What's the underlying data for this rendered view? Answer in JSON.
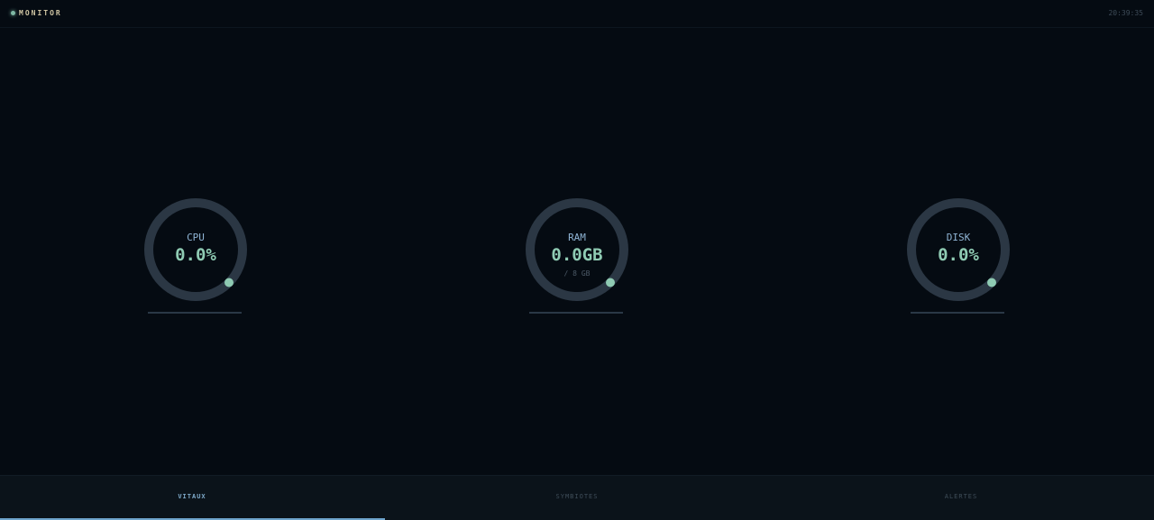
{
  "header": {
    "title": "MONITOR",
    "time": "20:39:35"
  },
  "gauges": {
    "cpu": {
      "label": "CPU",
      "value": "0.0%",
      "fraction": 0.0
    },
    "ram": {
      "label": "RAM",
      "value": "0.0GB",
      "sub": "/ 8 GB",
      "fraction": 0.0
    },
    "disk": {
      "label": "DISK",
      "value": "0.0%",
      "fraction": 0.0
    }
  },
  "nav": {
    "tabs": [
      {
        "label": "VITAUX",
        "active": true
      },
      {
        "label": "SYMBIOTES",
        "active": false
      },
      {
        "label": "ALERTES",
        "active": false
      }
    ]
  },
  "colors": {
    "background": "#050b12",
    "ring_track": "#2b3744",
    "accent": "#8fcbb3",
    "label": "#8fb4d4",
    "nav_active": "#7ea9c9"
  }
}
